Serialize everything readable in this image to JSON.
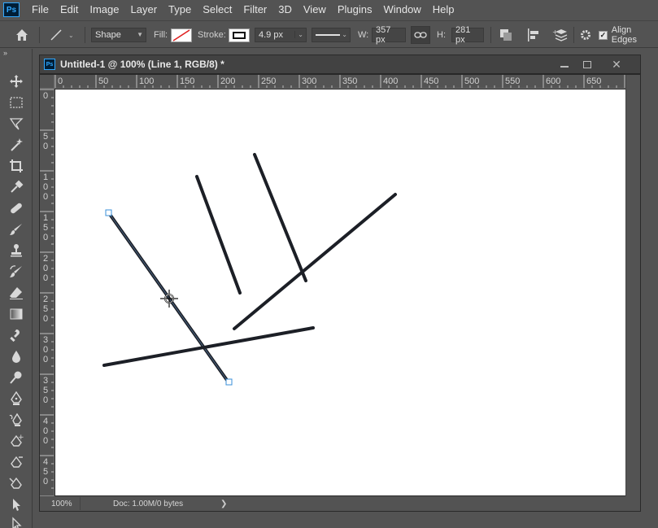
{
  "menubar": {
    "logo": "Ps",
    "items": [
      "File",
      "Edit",
      "Image",
      "Layer",
      "Type",
      "Select",
      "Filter",
      "3D",
      "View",
      "Plugins",
      "Window",
      "Help"
    ]
  },
  "options": {
    "mode": "Shape",
    "fill_label": "Fill:",
    "stroke_label": "Stroke:",
    "stroke_width": "4.9 px",
    "width_label": "W:",
    "width_value": "357 px",
    "height_label": "H:",
    "height_value": "281 px",
    "align_edges": "Align Edges",
    "align_edges_checked": true
  },
  "document": {
    "app_logo": "Ps",
    "title": "Untitled-1 @ 100% (Line 1, RGB/8) *",
    "h_ruler_labels": [
      "0",
      "50",
      "100",
      "150",
      "200",
      "250",
      "300",
      "350",
      "400",
      "450",
      "500",
      "550",
      "600",
      "650"
    ],
    "v_ruler_labels": [
      "0",
      "50",
      "100",
      "150",
      "200",
      "250",
      "300",
      "350",
      "400",
      "450"
    ],
    "zoom": "100%",
    "doc_info": "Doc: 1.00M/0 bytes",
    "status_arrow": "❯"
  },
  "colors": {
    "ui_bg": "#535353",
    "canvas": "#ffffff",
    "line_stroke": "#1c1f26",
    "anchor": "#3a8fd8"
  }
}
